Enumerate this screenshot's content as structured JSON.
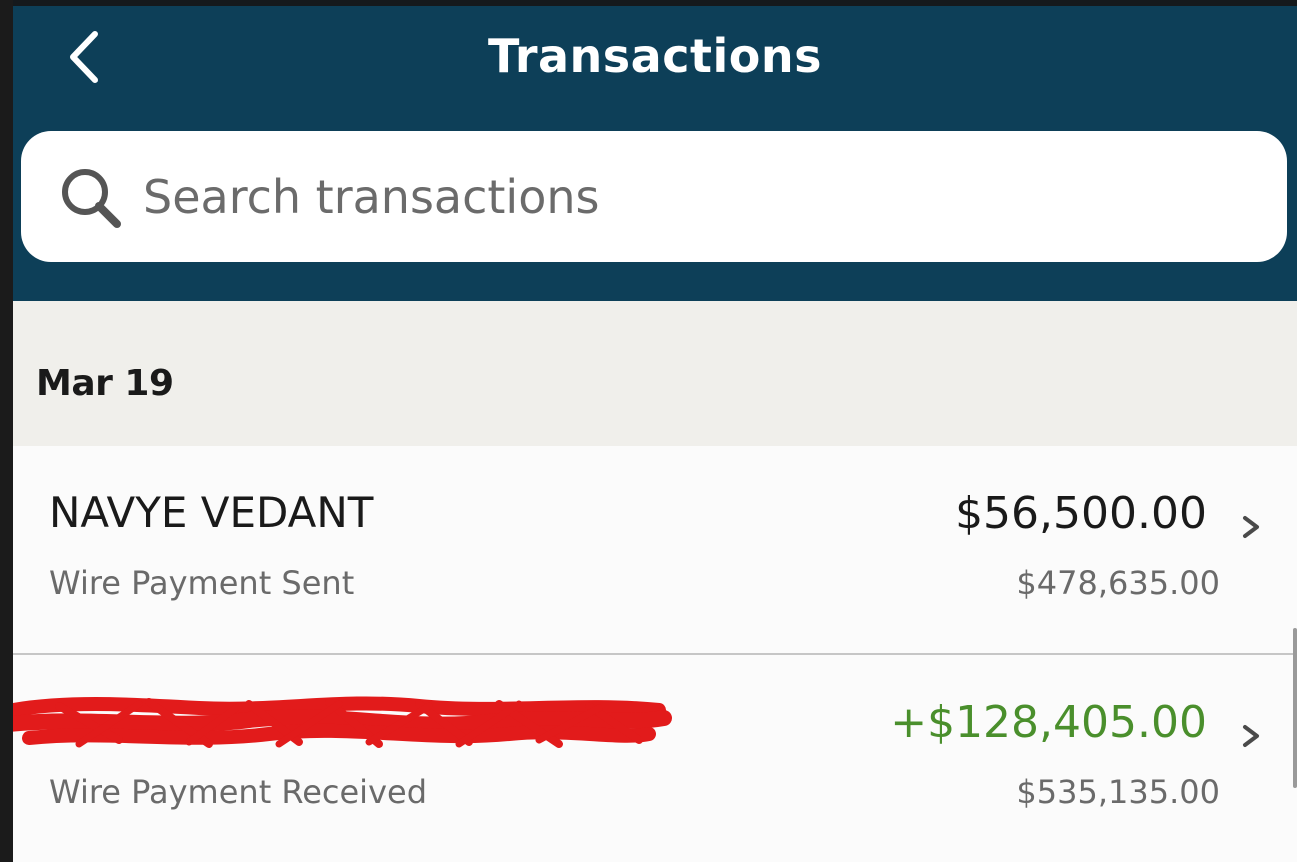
{
  "header": {
    "title": "Transactions",
    "back_icon": "chevron-left-icon"
  },
  "search": {
    "placeholder": "Search transactions",
    "icon": "search-icon"
  },
  "colors": {
    "header_bg": "#0d3f58",
    "credit": "#4a8f2c",
    "redaction": "#e21b1b"
  },
  "sections": [
    {
      "date": "Mar 19",
      "transactions": [
        {
          "name": "NAVYE VEDANT",
          "type": "Wire Payment Sent",
          "amount": "$56,500.00",
          "balance": "$478,635.00",
          "direction": "debit"
        },
        {
          "name": "",
          "name_redacted": true,
          "type": "Wire Payment Received",
          "amount": "+$128,405.00",
          "balance": "$535,135.00",
          "direction": "credit"
        }
      ]
    }
  ]
}
